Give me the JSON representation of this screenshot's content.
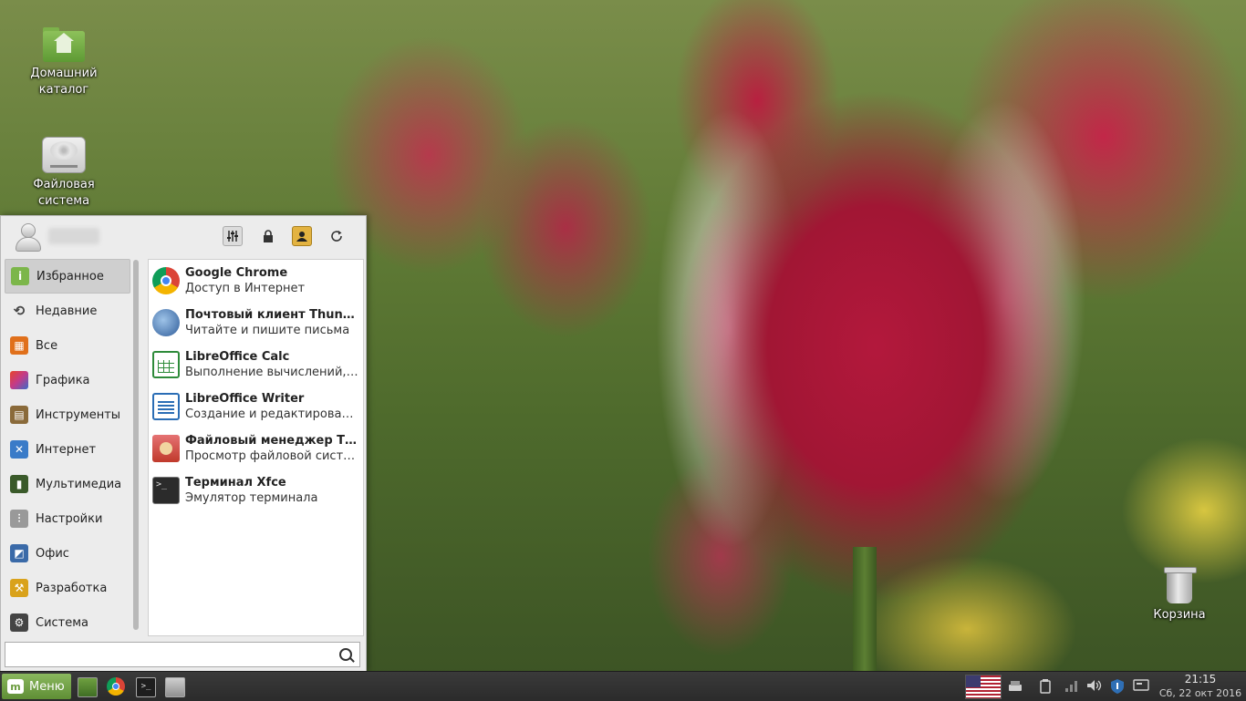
{
  "desktop": {
    "icons": [
      {
        "label": "Домашний каталог",
        "icon": "home-folder-icon"
      },
      {
        "label": "Файловая система",
        "icon": "hard-drive-icon"
      },
      {
        "label": "Корзина",
        "icon": "trash-icon"
      }
    ]
  },
  "menu": {
    "user_name": "",
    "header_buttons": [
      {
        "icon": "settings-icon"
      },
      {
        "icon": "lock-icon"
      },
      {
        "icon": "switch-user-icon"
      },
      {
        "icon": "logout-icon"
      }
    ],
    "categories": [
      {
        "label": "Избранное",
        "icon": "favorites-icon",
        "color": "#7cb64a",
        "active": true
      },
      {
        "label": "Недавние",
        "icon": "recent-icon",
        "color": "#555555",
        "active": false
      },
      {
        "label": "Все",
        "icon": "all-apps-icon",
        "color": "#e0701b",
        "active": false
      },
      {
        "label": "Графика",
        "icon": "graphics-icon",
        "color": "#c23b8a",
        "active": false
      },
      {
        "label": "Инструменты",
        "icon": "accessories-icon",
        "color": "#8a6a3a",
        "active": false
      },
      {
        "label": "Интернет",
        "icon": "internet-icon",
        "color": "#3a7bc8",
        "active": false
      },
      {
        "label": "Мультимедиа",
        "icon": "multimedia-icon",
        "color": "#3a5a2a",
        "active": false
      },
      {
        "label": "Настройки",
        "icon": "settings-category-icon",
        "color": "#777777",
        "active": false
      },
      {
        "label": "Офис",
        "icon": "office-icon",
        "color": "#3a6aa8",
        "active": false
      },
      {
        "label": "Разработка",
        "icon": "development-icon",
        "color": "#d9a21b",
        "active": false
      },
      {
        "label": "Система",
        "icon": "system-icon",
        "color": "#444444",
        "active": false
      }
    ],
    "apps": [
      {
        "name": "Google Chrome",
        "desc": "Доступ в Интернет",
        "icon": "chrome-icon"
      },
      {
        "name": "Почтовый клиент Thunde...",
        "desc": "Читайте и пишите письма",
        "icon": "thunderbird-icon"
      },
      {
        "name": "LibreOffice Calc",
        "desc": "Выполнение вычислений, а...",
        "icon": "calc-icon"
      },
      {
        "name": "LibreOffice Writer",
        "desc": "Создание и редактирование...",
        "icon": "writer-icon"
      },
      {
        "name": "Файловый менеджер Thu...",
        "desc": "Просмотр файловой систем...",
        "icon": "file-manager-icon"
      },
      {
        "name": "Терминал Xfce",
        "desc": "Эмулятор терминала",
        "icon": "terminal-icon"
      }
    ],
    "search": {
      "value": "",
      "placeholder": ""
    }
  },
  "taskbar": {
    "menu_label": "Меню",
    "launchers": [
      "show-desktop-icon",
      "chrome-icon",
      "terminal-icon",
      "file-manager-icon"
    ],
    "tray": [
      "keyboard-layout-flag-icon",
      "removable-drive-icon",
      "clipboard-icon",
      "network-icon",
      "volume-icon",
      "security-icon",
      "screen-icon"
    ],
    "time": "21:15",
    "date": "Сб, 22 окт 2016"
  }
}
